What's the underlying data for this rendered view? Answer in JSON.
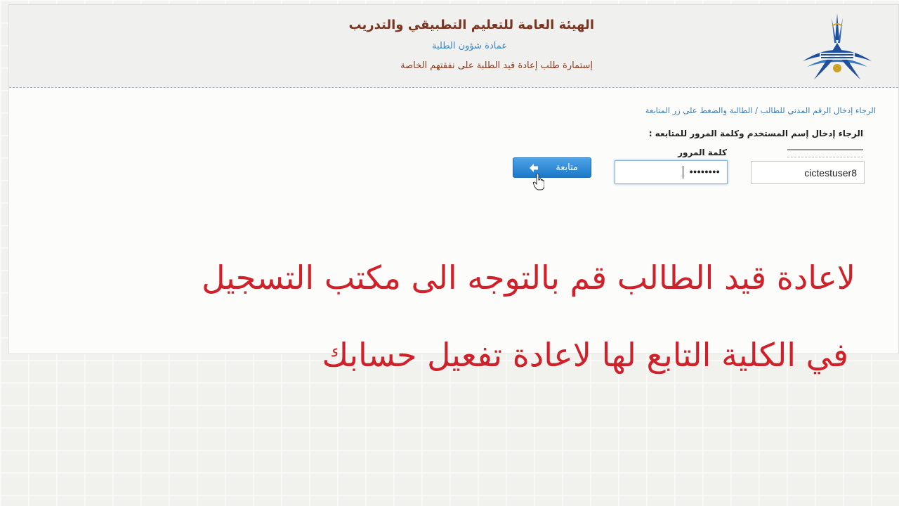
{
  "header": {
    "title": "الهيئة العامة للتعليم التطبيقي والتدريب",
    "deanship": "عمادة شؤون الطلبة",
    "form_title": "إستمارة طلب إعادة قيد الطلبة على نفقتهم الخاصة",
    "logo_icon": "paaet-logo-icon"
  },
  "form": {
    "instruction_civil_id": "الرجاء إدخال الرقم المدني للطالب / الطالبة والضغط على زر المتابعة",
    "instruction_credentials": "الرجاء إدخال إسم المستخدم وكلمة المرور للمتابعه :",
    "password_label": "كلمة المرور",
    "username_value": "cictestuser8",
    "password_mask": "●●●●●●●●",
    "continue_label": "متابعة"
  },
  "overlay": {
    "line1": "لاعادة قيد الطالب قم بالتوجه الى مكتب التسجيل",
    "line2": "في الكلية التابع لها  لاعادة تفعيل حسابك",
    "color": "#d0202a"
  },
  "colors": {
    "accent": "#2b86d2",
    "title": "#7a3520",
    "link": "#3f7fb7"
  }
}
